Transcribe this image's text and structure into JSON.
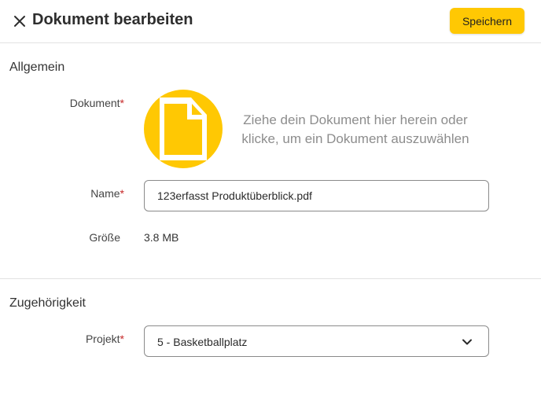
{
  "header": {
    "title": "Dokument bearbeiten",
    "save_label": "Speichern",
    "close_icon": "close-icon"
  },
  "general": {
    "section_title": "Allgemein",
    "document_label": "Dokument",
    "upload_text_line1": "Ziehe dein Dokument hier herein oder",
    "upload_text_line2": "klicke, um ein Dokument auszuwählen",
    "upload_icon": "document-icon",
    "name_label": "Name",
    "name_value": "123erfasst Produktüberblick.pdf",
    "size_label": "Größe",
    "size_value": "3.8 MB"
  },
  "association": {
    "section_title": "Zugehörigkeit",
    "project_label": "Projekt",
    "project_value": "5 - Basketballplatz",
    "dropdown_icon": "chevron-down-icon"
  },
  "required_marker": "*",
  "colors": {
    "accent": "#ffc803",
    "required": "#c62828",
    "divider": "#e2e2e2"
  }
}
